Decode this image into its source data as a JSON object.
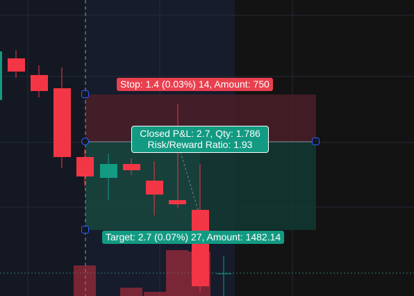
{
  "position": {
    "type": "short",
    "stop_label": "Stop: 1.4 (0.03%) 14, Amount: 750",
    "target_label": "Target: 2.7 (0.07%) 27, Amount: 1482.14",
    "closed_pnl_line": "Closed P&L: 2.7, Qty: 1.786",
    "risk_reward_line": "Risk/Reward Ratio: 1.93"
  },
  "colors": {
    "background": "#141823",
    "session_shade": "#131313",
    "bull_candle": "#139a82",
    "bear_candle": "#f23645",
    "stop_zone": "#4a1f28",
    "target_zone": "#133833",
    "handle_border": "#2962ff"
  },
  "icons": [
    "drag-handle-square",
    "drag-handle-circle"
  ]
}
